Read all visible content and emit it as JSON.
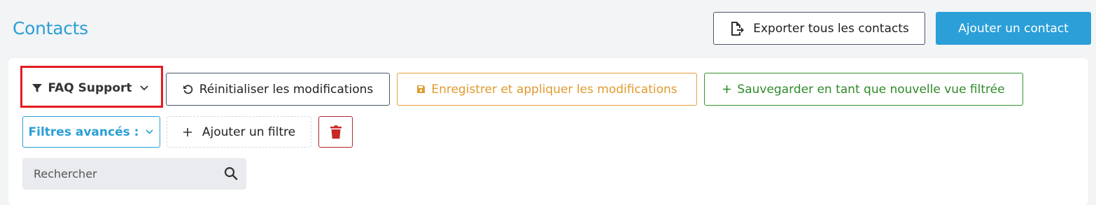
{
  "header": {
    "title": "Contacts",
    "export_label": "Exporter tous les contacts",
    "add_label": "Ajouter un contact"
  },
  "toolbar": {
    "view_label": "FAQ Support",
    "reset_label": "Réinitialiser les modifications",
    "save_label": "Enregistrer et appliquer les modifications",
    "save_as_label": "Sauvegarder en tant que nouvelle vue filtrée"
  },
  "filters": {
    "advanced_label": "Filtres avancés :",
    "add_filter_label": "Ajouter un filtre"
  },
  "search": {
    "placeholder": "Rechercher"
  },
  "icons": {
    "export": "file-export-icon",
    "view": "filter-icon",
    "view_chevron": "chevron-down-icon",
    "reset": "undo-icon",
    "save": "floppy-disk-icon",
    "save_as": "plus-icon",
    "advanced_chevron": "chevron-down-icon",
    "add_filter": "plus-icon",
    "delete": "trash-icon",
    "search": "search-icon"
  },
  "colors": {
    "accent": "#2b9fd8",
    "warning": "#e09a2e",
    "success": "#2f8a2a",
    "danger": "#c62828",
    "highlight": "#e41b23"
  }
}
